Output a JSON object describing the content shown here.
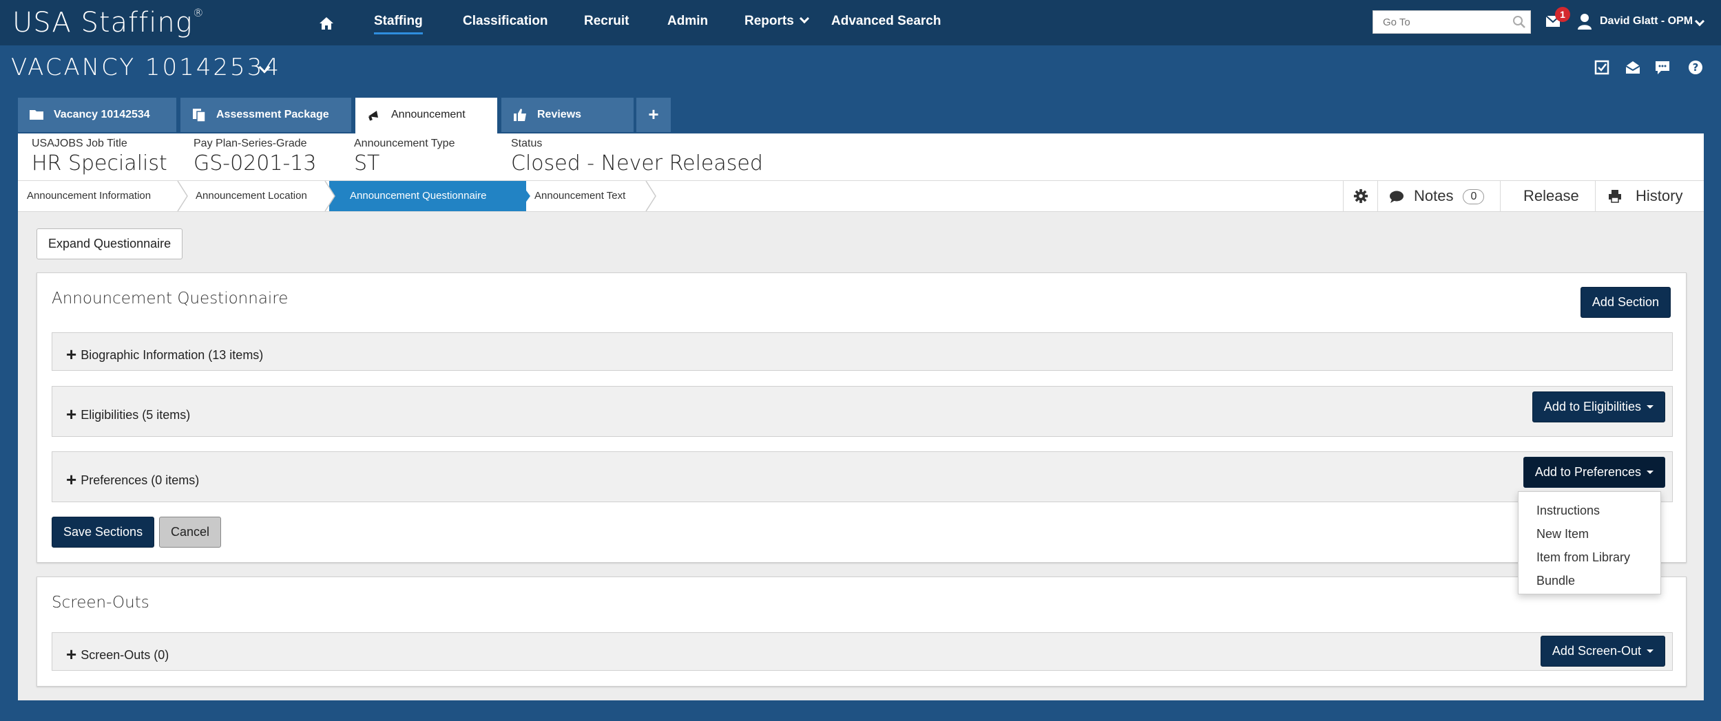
{
  "app": {
    "logo": "USA Staffing",
    "logo_mark": "®"
  },
  "nav": {
    "items": [
      "Staffing",
      "Classification",
      "Recruit",
      "Admin",
      "Reports",
      "Advanced Search"
    ],
    "active": "Staffing",
    "goto_placeholder": "Go To",
    "mail_count": "1",
    "user_name": "David Glatt - OPM"
  },
  "vacancy": {
    "title": "VACANCY 10142534"
  },
  "tabs": [
    {
      "label": "Vacancy 10142534",
      "icon": "folder-icon"
    },
    {
      "label": "Assessment Package",
      "icon": "documents-icon"
    },
    {
      "label": "Announcement",
      "icon": "megaphone-icon",
      "active": true
    },
    {
      "label": "Reviews",
      "icon": "thumbs-up-icon"
    }
  ],
  "info": [
    {
      "label": "USAJOBS Job Title",
      "value": "HR Specialist"
    },
    {
      "label": "Pay Plan-Series-Grade",
      "value": "GS-0201-13"
    },
    {
      "label": "Announcement Type",
      "value": "ST"
    },
    {
      "label": "Status",
      "value": "Closed - Never Released"
    }
  ],
  "breadcrumbs": [
    "Announcement Information",
    "Announcement Location",
    "Announcement Questionnaire",
    "Announcement Text"
  ],
  "actions": {
    "notes_label": "Notes",
    "notes_count": "0",
    "release_label": "Release",
    "history_label": "History"
  },
  "main": {
    "expand_button": "Expand Questionnaire",
    "questionnaire": {
      "title": "Announcement Questionnaire",
      "add_section_button": "Add Section",
      "sections": [
        {
          "label": "Biographic Information (13 items)"
        },
        {
          "label": "Eligibilities (5 items)",
          "button": "Add to Eligibilities"
        },
        {
          "label": "Preferences (0 items)",
          "button": "Add to Preferences"
        }
      ],
      "save_button": "Save Sections",
      "cancel_button": "Cancel"
    },
    "preferences_menu": [
      "Instructions",
      "New Item",
      "Item from Library",
      "Bundle"
    ],
    "screen_outs": {
      "title": "Screen-Outs",
      "section_label": "Screen-Outs (0)",
      "button": "Add Screen-Out"
    }
  }
}
